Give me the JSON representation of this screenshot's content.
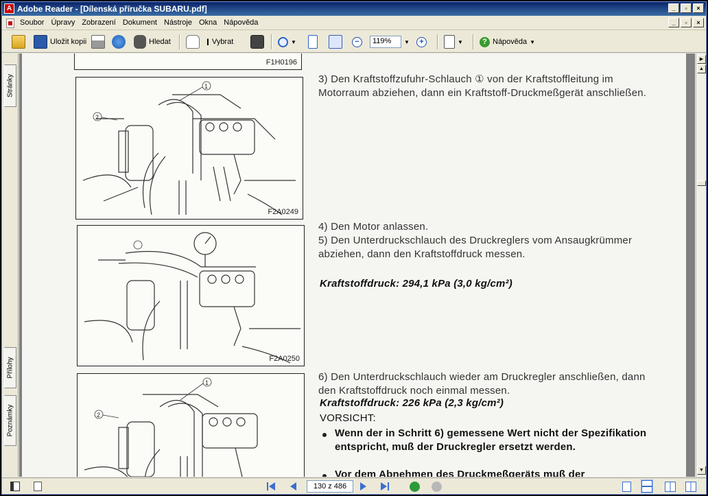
{
  "window": {
    "title": "Adobe Reader - [Dílenská příručka SUBARU.pdf]",
    "app_icon_glyph": "A"
  },
  "window_controls": [
    "_",
    "▫",
    "×"
  ],
  "menubar": {
    "items": [
      "Soubor",
      "Úpravy",
      "Zobrazení",
      "Dokument",
      "Nástroje",
      "Okna",
      "Nápověda"
    ]
  },
  "toolbar": {
    "save_copy": "Uložit kopii",
    "search": "Hledat",
    "select": "Vybrat",
    "zoom": "119%",
    "help": "Nápověda"
  },
  "side_tabs": {
    "pages": "Stránky",
    "attachments": "Přílohy",
    "comments": "Poznámky"
  },
  "document": {
    "top_figure_caption": "F1H0196",
    "fig1_caption": "F2A0249",
    "fig2_caption": "F2A0250",
    "callout_1": "1",
    "callout_2": "2",
    "step3": "3) Den Kraftstoffzufuhr-Schlauch ① von der Kraftstoffleitung im Motorraum abziehen, dann ein Kraftstoff-Druckmeßgerät anschließen.",
    "step4": "4) Den Motor anlassen.",
    "step5": "5) Den Unterdruckschlauch des Druckreglers vom Ansaugkrümmer abziehen, dann den Kraftstoffdruck messen.",
    "pressure1": "Kraftstoffdruck: 294,1 kPa (3,0 kg/cm²)",
    "step6": "6) Den Unterdruckschlauch wieder am Druckregler anschließen, dann den Kraftstoffdruck noch einmal messen.",
    "pressure2": "Kraftstoffdruck: 226 kPa (2,3 kg/cm²)",
    "caution": "VORSICHT:",
    "bullet1": "Wenn der in Schritt 6) gemessene Wert nicht der Spezifikation entspricht, muß der Druckregler ersetzt werden.",
    "bullet2": "Vor dem Abnehmen des Druckmeßgeräts muß der"
  },
  "status": {
    "page_indicator": "130 z 486"
  }
}
